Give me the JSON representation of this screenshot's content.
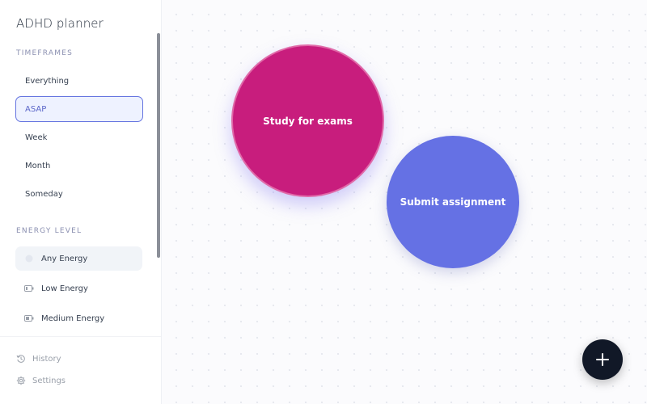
{
  "app": {
    "title": "ADHD planner"
  },
  "sidebar": {
    "timeframes_label": "TIMEFRAMES",
    "timeframes": [
      {
        "label": "Everything",
        "selected": false
      },
      {
        "label": "ASAP",
        "selected": true
      },
      {
        "label": "Week",
        "selected": false
      },
      {
        "label": "Month",
        "selected": false
      },
      {
        "label": "Someday",
        "selected": false
      }
    ],
    "energy_label": "ENERGY LEVEL",
    "energy": [
      {
        "label": "Any Energy",
        "icon": "circle-icon",
        "selected": true
      },
      {
        "label": "Low Energy",
        "icon": "battery-low-icon",
        "selected": false
      },
      {
        "label": "Medium Energy",
        "icon": "battery-medium-icon",
        "selected": false
      }
    ],
    "footer": [
      {
        "label": "History",
        "icon": "history-icon"
      },
      {
        "label": "Settings",
        "icon": "gear-icon"
      }
    ]
  },
  "canvas": {
    "tasks": [
      {
        "label": "Study for exams",
        "color": "#c81d7d"
      },
      {
        "label": "Submit assignment",
        "color": "#6571e4"
      }
    ]
  },
  "fab": {
    "icon": "plus-icon"
  },
  "colors": {
    "accent": "#6574e0",
    "primary_dark": "#111827"
  }
}
